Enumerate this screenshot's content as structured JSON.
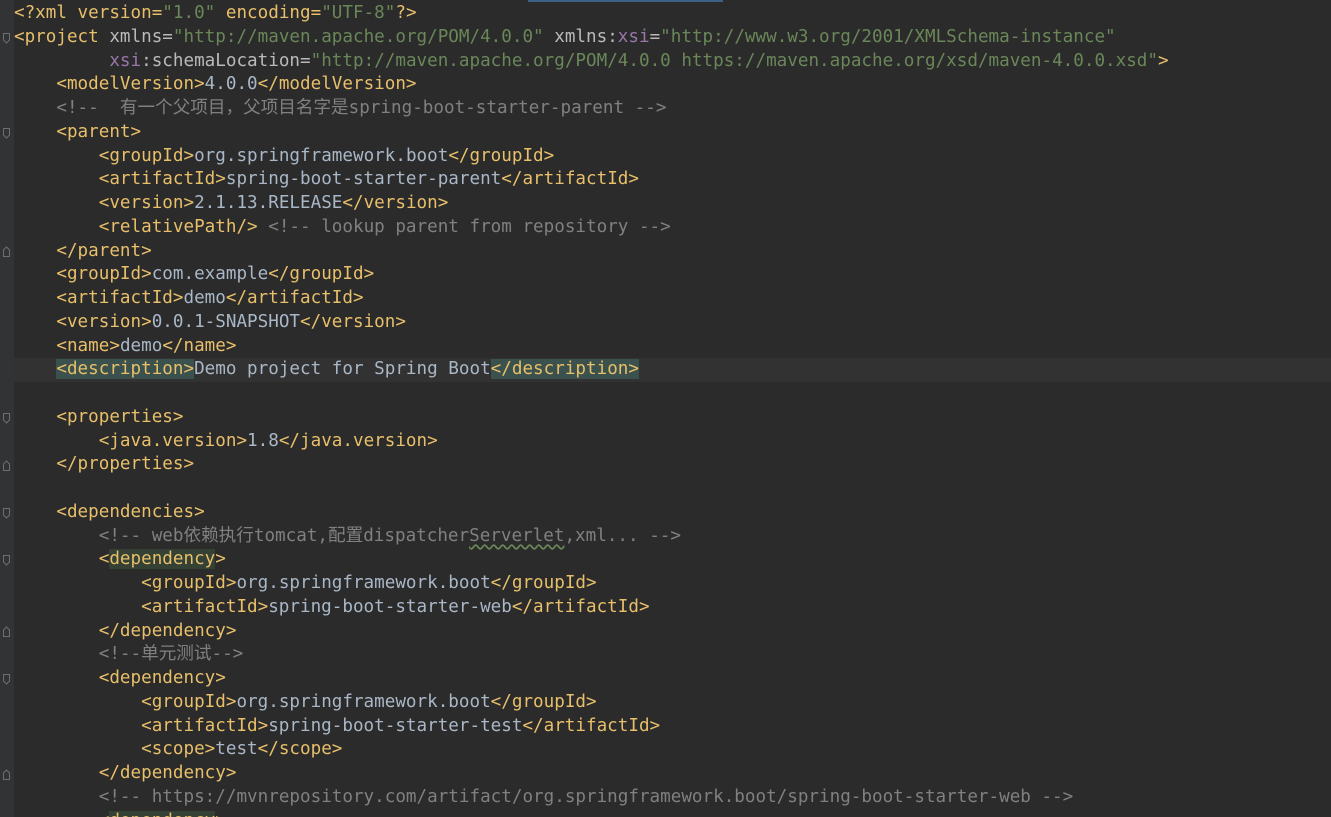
{
  "editor": {
    "file_language": "xml",
    "colors": {
      "background": "#2b2b2b",
      "gutter": "#313335",
      "tag": "#e8bf6a",
      "attribute": "#bababa",
      "string": "#6a8759",
      "text": "#a9b7c6",
      "comment": "#808080",
      "namespace": "#9876aa"
    },
    "lines": {
      "l1": [
        "<?xml version=",
        "\"1.0\"",
        " encoding=",
        "\"UTF-8\"",
        "?>"
      ],
      "l2": [
        "<project ",
        "xmlns=",
        "\"http://maven.apache.org/POM/4.0.0\"",
        " xmlns:",
        "xsi",
        "=",
        "\"http://www.w3.org/2001/XMLSchema-instance\""
      ],
      "l3": [
        "         ",
        "xsi",
        ":schemaLocation=",
        "\"http://maven.apache.org/POM/4.0.0 https://maven.apache.org/xsd/maven-4.0.0.xsd\"",
        ">"
      ],
      "l4": [
        "    ",
        "<modelVersion>",
        "4.0.0",
        "</modelVersion>"
      ],
      "l5": [
        "    ",
        "<!--  有一个父项目，父项目名字是spring-boot-starter-parent -->"
      ],
      "l6": [
        "    ",
        "<parent>"
      ],
      "l7": [
        "        ",
        "<groupId>",
        "org.springframework.boot",
        "</groupId>"
      ],
      "l8": [
        "        ",
        "<artifactId>",
        "spring-boot-starter-parent",
        "</artifactId>"
      ],
      "l9": [
        "        ",
        "<version>",
        "2.1.13.RELEASE",
        "</version>"
      ],
      "l10": [
        "        ",
        "<relativePath/>",
        " ",
        "<!-- lookup parent from repository -->"
      ],
      "l11": [
        "    ",
        "</parent>"
      ],
      "l12": [
        "    ",
        "<groupId>",
        "com.example",
        "</groupId>"
      ],
      "l13": [
        "    ",
        "<artifactId>",
        "demo",
        "</artifactId>"
      ],
      "l14": [
        "    ",
        "<version>",
        "0.0.1-SNAPSHOT",
        "</version>"
      ],
      "l15": [
        "    ",
        "<name>",
        "demo",
        "</name>"
      ],
      "l16": [
        "    ",
        "<description>",
        "Demo project for Spring Boot",
        "</description>"
      ],
      "l17": [
        ""
      ],
      "l18": [
        "    ",
        "<properties>"
      ],
      "l19": [
        "        ",
        "<java.version>",
        "1.8",
        "</java.version>"
      ],
      "l20": [
        "    ",
        "</properties>"
      ],
      "l21": [
        ""
      ],
      "l22": [
        "    ",
        "<dependencies>"
      ],
      "l23": [
        "        ",
        "<!-- web依赖执行tomcat,配置dispatcher",
        "Serverlet",
        ",xml... -->"
      ],
      "l24": [
        "        ",
        "<",
        "dependency",
        ">"
      ],
      "l25": [
        "            ",
        "<groupId>",
        "org.springframework.boot",
        "</groupId>"
      ],
      "l26": [
        "            ",
        "<artifactId>",
        "spring-boot-starter-web",
        "</artifactId>"
      ],
      "l27": [
        "        ",
        "</dependency>"
      ],
      "l28": [
        "        ",
        "<!--单元测试-->"
      ],
      "l29": [
        "        ",
        "<dependency>"
      ],
      "l30": [
        "            ",
        "<groupId>",
        "org.springframework.boot",
        "</groupId>"
      ],
      "l31": [
        "            ",
        "<artifactId>",
        "spring-boot-starter-test",
        "</artifactId>"
      ],
      "l32": [
        "            ",
        "<scope>",
        "test",
        "</scope>"
      ],
      "l33": [
        "        ",
        "</dependency>"
      ],
      "l34": [
        "        ",
        "<!-- https://mvnrepository.com/artifact/org.springframework.boot/spring-boot-starter-web -->"
      ],
      "l35": [
        "        ",
        "<",
        "dependency",
        ">"
      ]
    }
  }
}
